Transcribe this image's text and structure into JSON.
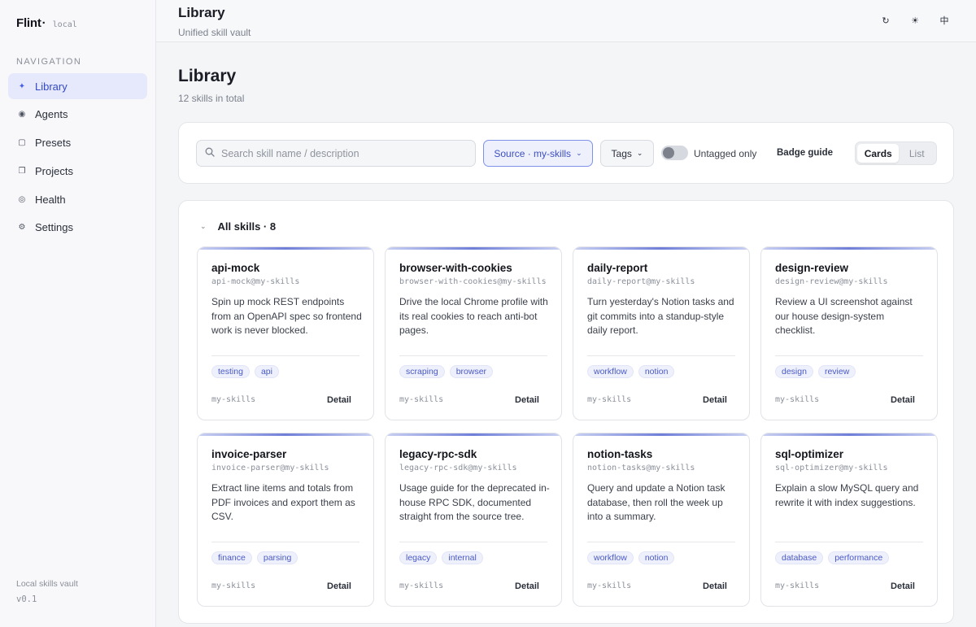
{
  "sidebar": {
    "brand": "Flint",
    "brand_dot": "·",
    "brand_tag": "local",
    "nav_title": "NAVIGATION",
    "items": [
      {
        "label": "Library",
        "icon": "sparkle-icon"
      },
      {
        "label": "Agents",
        "icon": "agent-icon"
      },
      {
        "label": "Presets",
        "icon": "square-icon"
      },
      {
        "label": "Projects",
        "icon": "project-icon"
      },
      {
        "label": "Health",
        "icon": "health-icon"
      },
      {
        "label": "Settings",
        "icon": "gear-icon"
      }
    ],
    "footer_line1": "Local skills vault",
    "footer_line2": "v0.1"
  },
  "header": {
    "title": "Library",
    "subtitle": "Unified skill vault",
    "refresh_icon": "↻",
    "theme_icon": "☀",
    "lang_label": "中"
  },
  "main": {
    "title": "Library",
    "subtitle": "12 skills in total"
  },
  "toolbar": {
    "search_placeholder": "Search skill name / description",
    "search_value": "",
    "source_label": "Source · my-skills",
    "tags_label": "Tags",
    "untagged_label": "Untagged only",
    "untagged_on": false,
    "badge_guide_label": "Badge guide",
    "view_cards": "Cards",
    "view_list": "List",
    "view_selected": "Cards"
  },
  "section": {
    "title": "All skills · 8"
  },
  "cards": [
    {
      "name": "api-mock",
      "id": "api-mock@my-skills",
      "desc": "Spin up mock REST endpoints from an OpenAPI spec so frontend work is never blocked.",
      "tags": [
        "testing",
        "api"
      ],
      "source": "my-skills",
      "detail": "Detail"
    },
    {
      "name": "browser-with-cookies",
      "id": "browser-with-cookies@my-skills",
      "desc": "Drive the local Chrome profile with its real cookies to reach anti-bot pages.",
      "tags": [
        "scraping",
        "browser"
      ],
      "source": "my-skills",
      "detail": "Detail"
    },
    {
      "name": "daily-report",
      "id": "daily-report@my-skills",
      "desc": "Turn yesterday's Notion tasks and git commits into a standup-style daily report.",
      "tags": [
        "workflow",
        "notion"
      ],
      "source": "my-skills",
      "detail": "Detail"
    },
    {
      "name": "design-review",
      "id": "design-review@my-skills",
      "desc": "Review a UI screenshot against our house design-system checklist.",
      "tags": [
        "design",
        "review"
      ],
      "source": "my-skills",
      "detail": "Detail"
    },
    {
      "name": "invoice-parser",
      "id": "invoice-parser@my-skills",
      "desc": "Extract line items and totals from PDF invoices and export them as CSV.",
      "tags": [
        "finance",
        "parsing"
      ],
      "source": "my-skills",
      "detail": "Detail"
    },
    {
      "name": "legacy-rpc-sdk",
      "id": "legacy-rpc-sdk@my-skills",
      "desc": "Usage guide for the deprecated in-house RPC SDK, documented straight from the source tree.",
      "tags": [
        "legacy",
        "internal"
      ],
      "source": "my-skills",
      "detail": "Detail"
    },
    {
      "name": "notion-tasks",
      "id": "notion-tasks@my-skills",
      "desc": "Query and update a Notion task database, then roll the week up into a summary.",
      "tags": [
        "workflow",
        "notion"
      ],
      "source": "my-skills",
      "detail": "Detail"
    },
    {
      "name": "sql-optimizer",
      "id": "sql-optimizer@my-skills",
      "desc": "Explain a slow MySQL query and rewrite it with index suggestions.",
      "tags": [
        "database",
        "performance"
      ],
      "source": "my-skills",
      "detail": "Detail"
    }
  ],
  "colors": {
    "accent": "#4a62e0",
    "active_nav_bg": "#e5e9fb",
    "tag_text": "#4a5ac6"
  }
}
